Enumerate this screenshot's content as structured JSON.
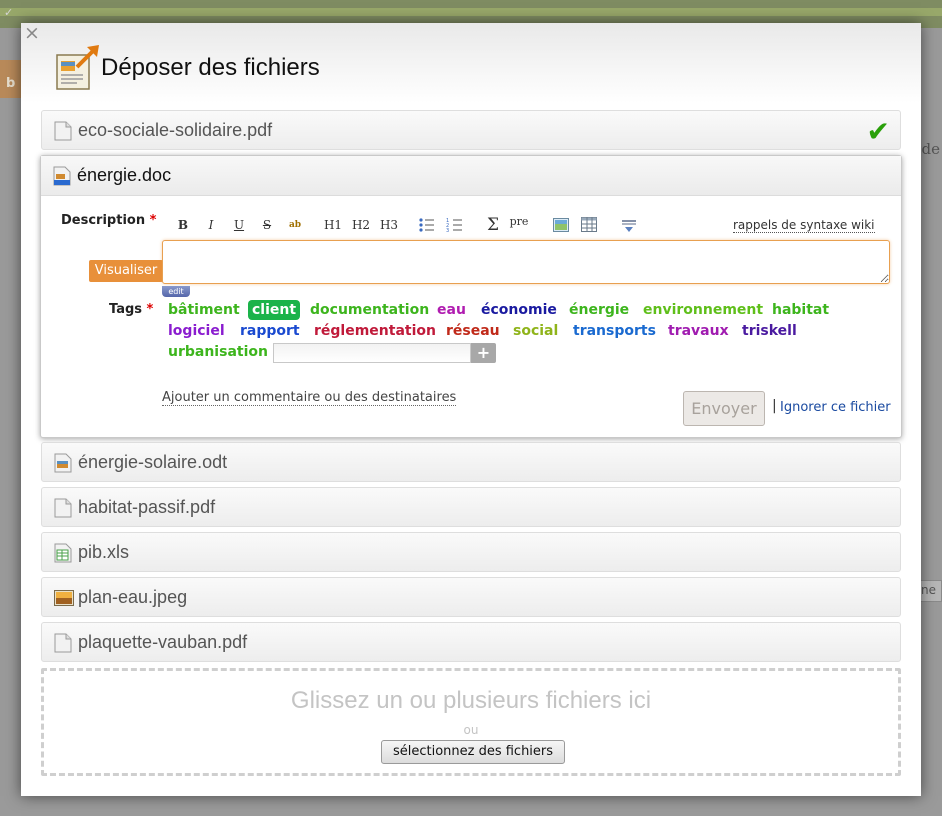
{
  "dialog": {
    "title": "Déposer des fichiers",
    "close_label": "×"
  },
  "files": [
    {
      "name": "eco-sociale-solidaire.pdf",
      "icon": "pdf-file-icon",
      "status": "uploaded"
    },
    {
      "name": "énergie.doc",
      "icon": "doc-file-icon",
      "status": "editing"
    },
    {
      "name": "énergie-solaire.odt",
      "icon": "odt-file-icon"
    },
    {
      "name": "habitat-passif.pdf",
      "icon": "pdf-file-icon"
    },
    {
      "name": "pib.xls",
      "icon": "spreadsheet-file-icon"
    },
    {
      "name": "plan-eau.jpeg",
      "icon": "image-file-icon"
    },
    {
      "name": "plaquette-vauban.pdf",
      "icon": "pdf-file-icon"
    }
  ],
  "form": {
    "description_label": "Description",
    "required_mark": "*",
    "tags_label": "Tags",
    "preview_button": "Visualiser",
    "edit_tab": "edit",
    "syntax_help": "rappels de syntaxe wiki",
    "toolbar": {
      "bold": "B",
      "italic": "I",
      "underline": "U",
      "strike": "S",
      "highlight": "ab",
      "h1": "H1",
      "h2": "H2",
      "h3": "H3",
      "sum": "Σ",
      "pre": "pre"
    },
    "description_value": "",
    "add_comment_link": "Ajouter un commentaire ou des destinataires",
    "send_button": "Envoyer",
    "separator": "|",
    "ignore_link": "Ignorer ce fichier",
    "tag_input_value": "",
    "tag_add_label": "+"
  },
  "tags": [
    {
      "label": "bâtiment",
      "color": "#3db51d",
      "selected": false
    },
    {
      "label": "client",
      "color": "#1bb34a",
      "selected": true
    },
    {
      "label": "documentation",
      "color": "#3db51d",
      "selected": false
    },
    {
      "label": "eau",
      "color": "#b01cb0",
      "selected": false
    },
    {
      "label": "économie",
      "color": "#1a1aa0",
      "selected": false
    },
    {
      "label": "énergie",
      "color": "#3db51d",
      "selected": false
    },
    {
      "label": "environnement",
      "color": "#5fbf1a",
      "selected": false
    },
    {
      "label": "habitat",
      "color": "#3db51d",
      "selected": false
    },
    {
      "label": "logiciel",
      "color": "#8a1ccf",
      "selected": false
    },
    {
      "label": "rapport",
      "color": "#1a4ad0",
      "selected": false
    },
    {
      "label": "réglementation",
      "color": "#c01a3a",
      "selected": false
    },
    {
      "label": "réseau",
      "color": "#c02a1a",
      "selected": false
    },
    {
      "label": "social",
      "color": "#8fb41a",
      "selected": false
    },
    {
      "label": "transports",
      "color": "#1a6ad0",
      "selected": false
    },
    {
      "label": "travaux",
      "color": "#a01cb0",
      "selected": false
    },
    {
      "label": "triskell",
      "color": "#4a1aa0",
      "selected": false
    },
    {
      "label": "urbanisation",
      "color": "#3db51d",
      "selected": false
    }
  ],
  "dropzone": {
    "title": "Glissez un ou plusieurs fichiers ici",
    "or": "ou",
    "select_button": "sélectionnez des fichiers"
  },
  "background": {
    "right_text": "de",
    "right_box": "ne",
    "letter": "b"
  }
}
